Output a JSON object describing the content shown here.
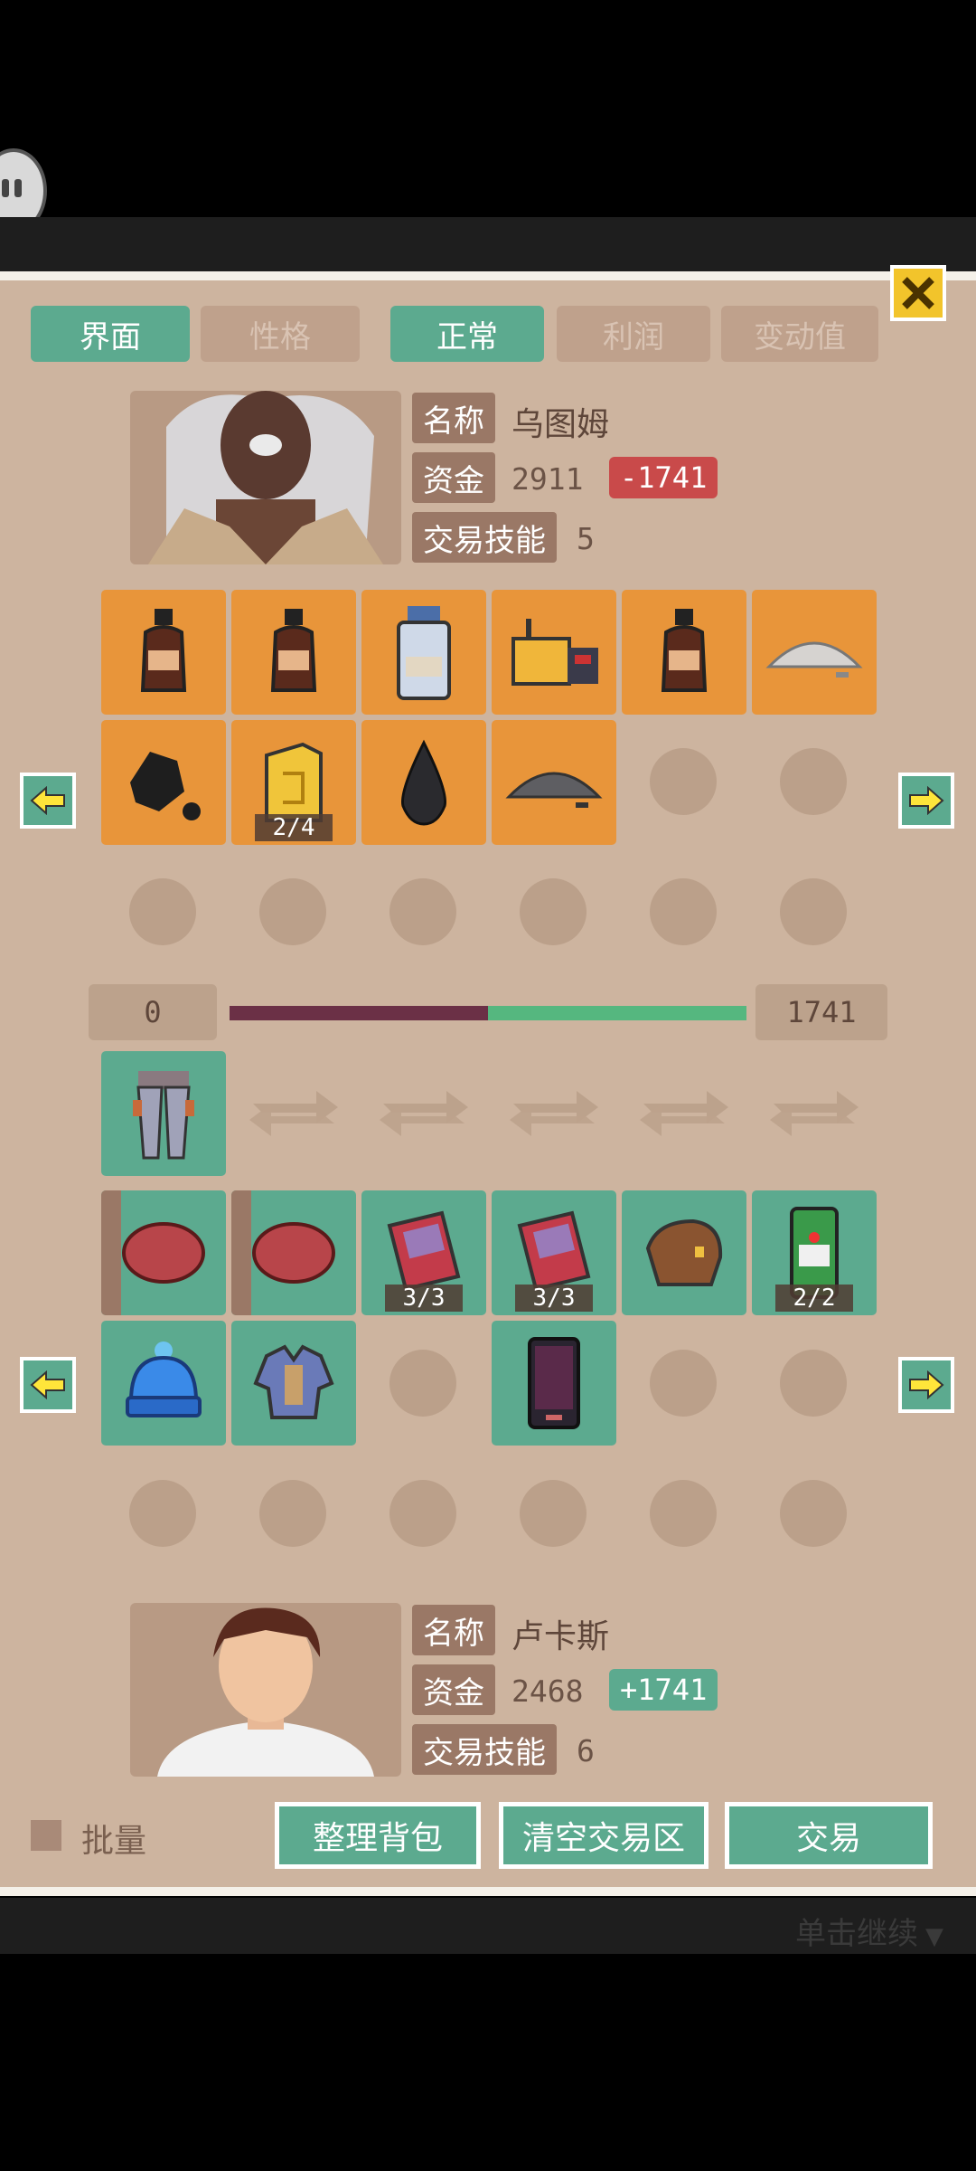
{
  "tabs": [
    {
      "label": "界面",
      "active": true
    },
    {
      "label": "性格",
      "active": false
    },
    {
      "label": "正常",
      "active": true
    },
    {
      "label": "利润",
      "active": false
    },
    {
      "label": "变动值",
      "active": false
    }
  ],
  "trader": {
    "name_label": "名称",
    "name": "乌图姆",
    "funds_label": "资金",
    "funds": "2911",
    "funds_delta": "-1741",
    "skill_label": "交易技能",
    "skill": "5"
  },
  "trader_items": [
    {
      "icon": "bottle-icon"
    },
    {
      "icon": "bottle-icon"
    },
    {
      "icon": "jar-icon"
    },
    {
      "icon": "radio-icon"
    },
    {
      "icon": "bottle-icon"
    },
    {
      "icon": "powder-pile-icon"
    },
    {
      "icon": "coal-icon"
    },
    {
      "icon": "fuel-can-icon",
      "count": "2/4"
    },
    {
      "icon": "oil-drop-icon"
    },
    {
      "icon": "dark-powder-icon"
    }
  ],
  "balance": {
    "left": "0",
    "right": "1741",
    "fraction": 0.5
  },
  "trade_slot": {
    "icon": "pants-icon"
  },
  "player_items": [
    {
      "icon": "meat-icon"
    },
    {
      "icon": "meat-icon"
    },
    {
      "icon": "book-icon",
      "count": "3/3"
    },
    {
      "icon": "book-icon",
      "count": "3/3"
    },
    {
      "icon": "bag-icon"
    },
    {
      "icon": "beer-can-icon",
      "count": "2/2"
    },
    {
      "icon": "beanie-icon"
    },
    {
      "icon": "armor-icon"
    },
    {
      "icon": "phone-icon"
    }
  ],
  "player": {
    "name_label": "名称",
    "name": "卢卡斯",
    "funds_label": "资金",
    "funds": "2468",
    "funds_delta": "+1741",
    "skill_label": "交易技能",
    "skill": "6"
  },
  "bulk_label": "批量",
  "buttons": {
    "sort": "整理背包",
    "clear": "清空交易区",
    "trade": "交易"
  },
  "continue_hint": "单击继续",
  "colors": {
    "panel": "#cdb49f",
    "accent": "#5caa8f",
    "orange_slot": "#e8953a",
    "negative": "#c94a4a",
    "balance_left": "#6b3046",
    "balance_right": "#55b77f"
  }
}
